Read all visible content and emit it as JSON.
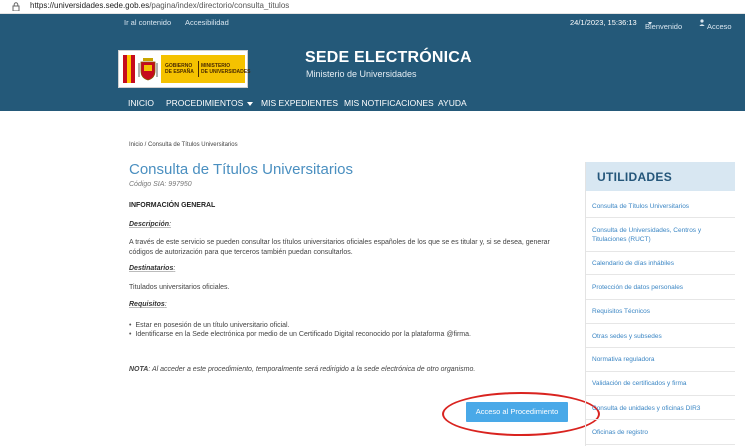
{
  "browser": {
    "url_host": "https://universidades.sede.gob.es",
    "url_path": "/pagina/index/directorio/consulta_titulos"
  },
  "header": {
    "skip_link": "Ir al contenido",
    "accessibility": "Accesibilidad",
    "datetime": "24/1/2023, 15:36:13",
    "welcome": "Bienvenido",
    "access": "Acceso",
    "logo_gob": "GOBIERNO\nDE ESPAÑA",
    "logo_min": "MINISTERIO\nDE UNIVERSIDADES",
    "title": "SEDE ELECTRÓNICA",
    "subtitle": "Ministerio de Universidades"
  },
  "nav": {
    "items": [
      "INICIO",
      "PROCEDIMIENTOS",
      "MIS EXPEDIENTES",
      "MIS NOTIFICACIONES",
      "AYUDA"
    ]
  },
  "main": {
    "breadcrumb": "Inicio / Consulta de Títulos Universitarios",
    "title": "Consulta de Títulos Universitarios",
    "code": "Código SIA: 997950",
    "section_title": "INFORMACIÓN GENERAL",
    "desc_label": "Descripción",
    "desc_colon": ":",
    "desc_text": "A través de este servicio se pueden consultar los títulos universitarios oficiales españoles de los que se es titular y, si se desea, generar códigos de autorización para que terceros también puedan consultarlos.",
    "dest_label": "Destinatarios",
    "dest_colon": ":",
    "dest_text": "Titulados universitarios oficiales.",
    "req_label": "Requisitos",
    "req_colon": ":",
    "requirements": [
      "Estar en posesión de un título universitario oficial.",
      "Identificarse en la Sede electrónica por medio de un Certificado Digital reconocido por la plataforma @firma."
    ],
    "note_label": "NOTA",
    "note_text": ": Al acceder a este procedimiento, temporalmente será redirigido a la sede electrónica de otro organismo.",
    "cta": "Acceso al Procedimiento"
  },
  "sidebar": {
    "title": "UTILIDADES",
    "items": [
      "Consulta de Títulos Universitarios",
      "Consulta de Universidades, Centros y Titulaciones (RUCT)",
      "Calendario de días inhábiles",
      "Protección de datos personales",
      "Requisitos Técnicos",
      "Otras sedes y subsedes",
      "Normativa reguladora",
      "Validación de certificados y firma",
      "Consulta de unidades y oficinas DIR3",
      "Oficinas de registro"
    ]
  },
  "colors": {
    "header_bg": "#245979",
    "title_blue": "#4a8fc0",
    "cta_bg": "#49a9e8",
    "annotation": "#d9231f"
  }
}
